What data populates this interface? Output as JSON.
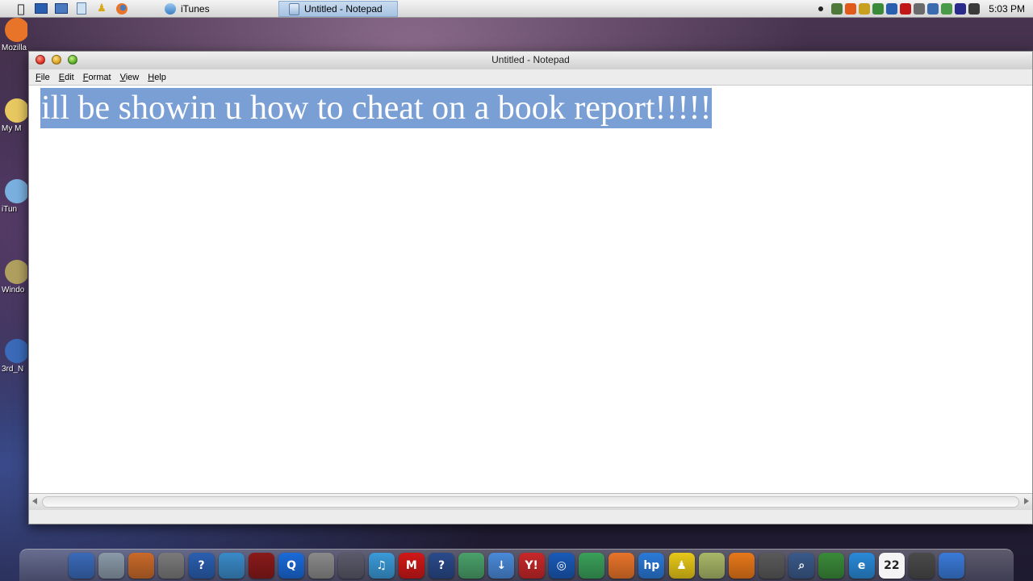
{
  "menubar": {
    "apple_icon": "apple-icon",
    "quick_icons": [
      "windows-icon",
      "network-icon",
      "notepad-icon",
      "aim-icon",
      "firefox-icon"
    ],
    "tasks": [
      {
        "label": "iTunes",
        "active": false
      },
      {
        "label": "Untitled - Notepad",
        "active": true
      }
    ],
    "tray_colors": [
      "#4d7a3a",
      "#e05a1a",
      "#c8a020",
      "#3a8a3a",
      "#2a5fb0",
      "#c01818",
      "#6a6a6a",
      "#3a6ab0",
      "#4a9a4a",
      "#2a2a8a",
      "#3a3a3a"
    ],
    "clock": "5:03 PM"
  },
  "desktop": {
    "icons": [
      {
        "label": "Mozilla",
        "color": "#e8742a"
      },
      {
        "label": "My M",
        "color": "#e8c860"
      },
      {
        "label": "iTun",
        "color": "#7ab0e0"
      },
      {
        "label": "Windo",
        "color": "#b0a060"
      },
      {
        "label": "3rd_N",
        "color": "#3a6ab8"
      }
    ]
  },
  "window": {
    "title": "Untitled - Notepad",
    "menu": [
      "File",
      "Edit",
      "Format",
      "View",
      "Help"
    ],
    "content": "ill be showin u how to cheat on a book report!!!!!",
    "selection_color": "#7a9fd4"
  },
  "dock": {
    "icons": [
      {
        "name": "finder-icon",
        "color": "#3a6ab8",
        "glyph": ""
      },
      {
        "name": "folder-icon",
        "color": "#8a9aa8",
        "glyph": ""
      },
      {
        "name": "paint-icon",
        "color": "#c86a2a",
        "glyph": ""
      },
      {
        "name": "system-icon",
        "color": "#7a7a7a",
        "glyph": ""
      },
      {
        "name": "help-icon",
        "color": "#2a5fb0",
        "glyph": "?"
      },
      {
        "name": "media-icon",
        "color": "#3a8ac8",
        "glyph": ""
      },
      {
        "name": "record-icon",
        "color": "#8a1a1a",
        "glyph": ""
      },
      {
        "name": "quicktime-icon",
        "color": "#1a6ad8",
        "glyph": "Q"
      },
      {
        "name": "tools-icon",
        "color": "#8a8a8a",
        "glyph": ""
      },
      {
        "name": "utility-icon",
        "color": "#5a5a6a",
        "glyph": ""
      },
      {
        "name": "itunes-icon",
        "color": "#3a9ad8",
        "glyph": "♫"
      },
      {
        "name": "m-app-icon",
        "color": "#d01818",
        "glyph": "M"
      },
      {
        "name": "help2-icon",
        "color": "#2a4a8a",
        "glyph": "?"
      },
      {
        "name": "window-icon",
        "color": "#4aa06a",
        "glyph": ""
      },
      {
        "name": "download-icon",
        "color": "#4a8ad8",
        "glyph": "↓"
      },
      {
        "name": "yahoo-icon",
        "color": "#c8282a",
        "glyph": "Y!"
      },
      {
        "name": "disc-icon",
        "color": "#1a5ab8",
        "glyph": "◎"
      },
      {
        "name": "messenger-icon",
        "color": "#3aa05a",
        "glyph": ""
      },
      {
        "name": "firefox-dock-icon",
        "color": "#e8742a",
        "glyph": ""
      },
      {
        "name": "hp-icon",
        "color": "#2a7ad8",
        "glyph": "hp"
      },
      {
        "name": "aim-dock-icon",
        "color": "#e8c818",
        "glyph": "♟"
      },
      {
        "name": "notes-icon",
        "color": "#a8b868",
        "glyph": ""
      },
      {
        "name": "antivirus-icon",
        "color": "#e8781a",
        "glyph": ""
      },
      {
        "name": "settings-icon",
        "color": "#5a5a5a",
        "glyph": ""
      },
      {
        "name": "search-icon",
        "color": "#3a5a8a",
        "glyph": "⌕"
      },
      {
        "name": "game-icon",
        "color": "#3a8a3a",
        "glyph": ""
      },
      {
        "name": "ie-icon",
        "color": "#2a8ad8",
        "glyph": "e"
      },
      {
        "name": "calendar-icon",
        "color": "#f4f4f4",
        "glyph": "22"
      },
      {
        "name": "shadow-icon",
        "color": "#4a4a4a",
        "glyph": ""
      },
      {
        "name": "desktop-icon",
        "color": "#3a7ad8",
        "glyph": ""
      }
    ]
  }
}
